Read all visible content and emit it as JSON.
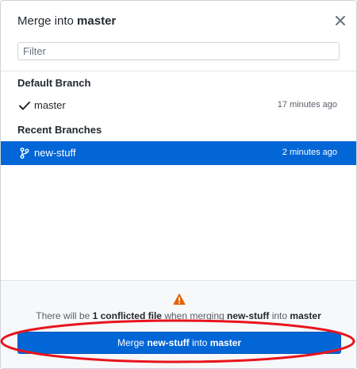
{
  "dialog": {
    "title_prefix": "Merge into",
    "title_branch": "master",
    "close_icon": "close-icon"
  },
  "filter": {
    "placeholder": "Filter",
    "value": ""
  },
  "default_branch": {
    "section_title": "Default Branch",
    "name": "master",
    "time": "17 minutes ago",
    "icon": "checkmark-icon"
  },
  "recent_branches": {
    "section_title": "Recent Branches",
    "items": [
      {
        "name": "new-stuff",
        "time": "2 minutes ago",
        "icon": "branch-icon",
        "selected": true
      }
    ]
  },
  "warning": {
    "icon": "warning-icon",
    "part1": "There will be",
    "count": "1 conflicted file",
    "part2": "when merging",
    "source": "new-stuff",
    "part3": "into",
    "target": "master"
  },
  "merge_button": {
    "part1": "Merge",
    "source": "new-stuff",
    "part2": "into",
    "target": "master"
  },
  "colors": {
    "accent": "#0366d6",
    "warning": "#e36209",
    "annotation": "#e8141c"
  }
}
